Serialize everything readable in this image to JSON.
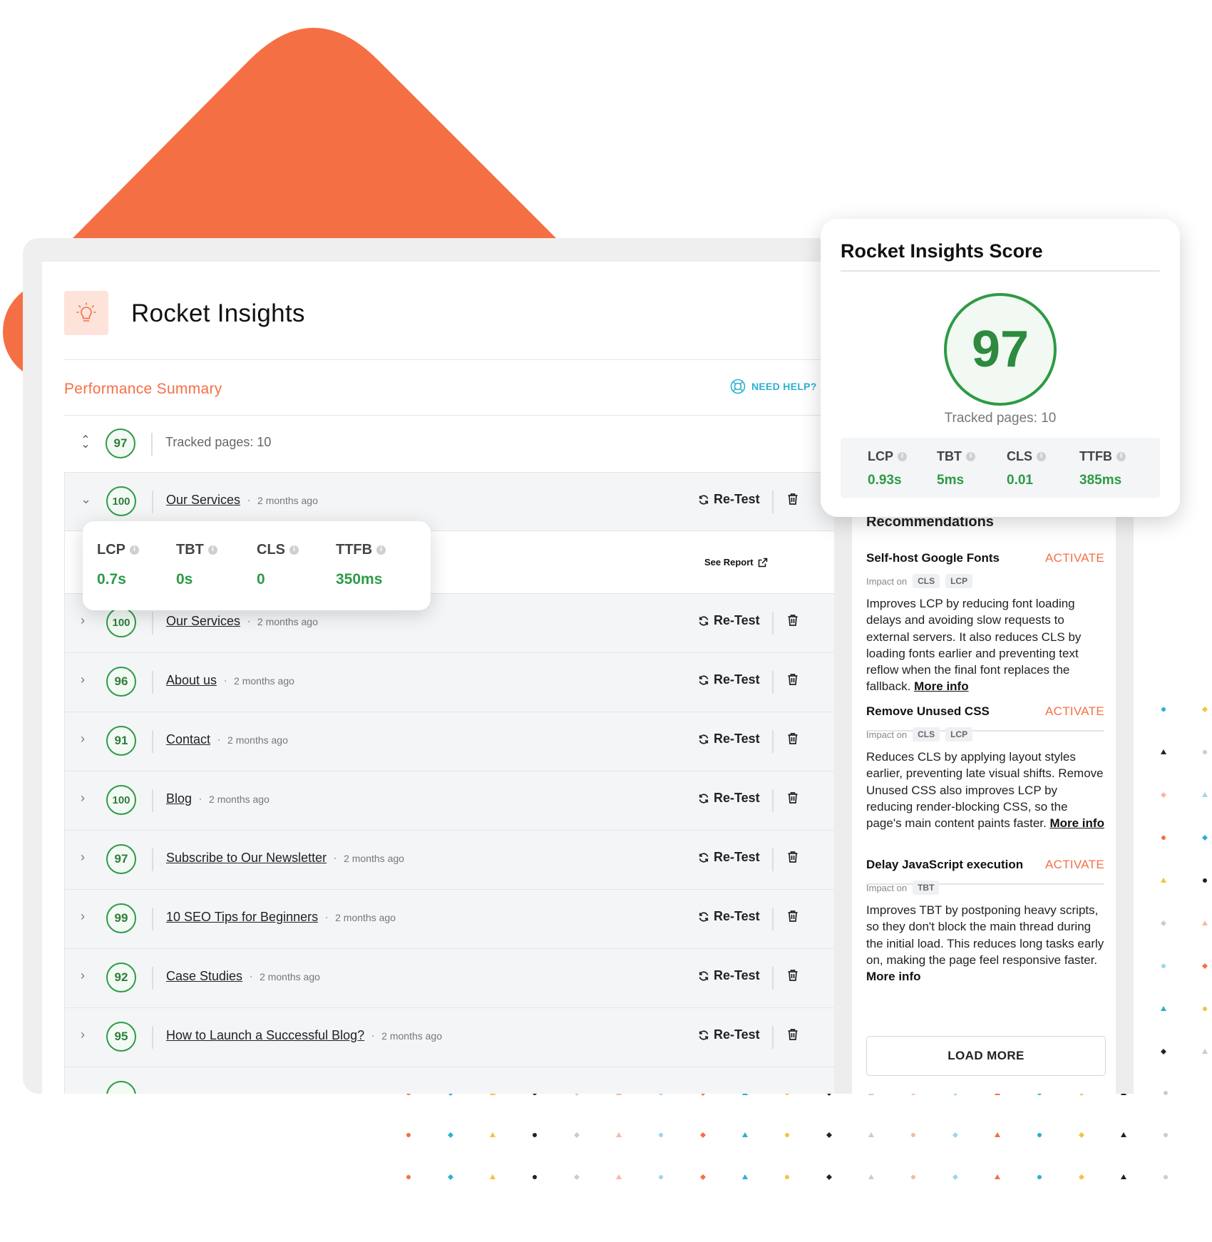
{
  "colors": {
    "accent": "#f56f45",
    "score_green": "#2e9a47",
    "help_cyan": "#2cb0cf"
  },
  "app": {
    "title": "Rocket Insights",
    "logo_icon": "lightbulb-icon"
  },
  "performance": {
    "title": "Performance Summary",
    "need_help": "NEED HELP?",
    "summary_score": "97",
    "tracked_pages": "Tracked pages: 10"
  },
  "expanded_metrics": {
    "see_report": "See Report",
    "items": [
      {
        "label": "LCP",
        "value": "0.7s"
      },
      {
        "label": "TBT",
        "value": "0s"
      },
      {
        "label": "CLS",
        "value": "0"
      },
      {
        "label": "TTFB",
        "value": "350ms"
      }
    ]
  },
  "retest_label": "Re-Test",
  "pages": [
    {
      "score": "100",
      "name": "Our Services",
      "ago": "2 months ago"
    },
    {
      "score": "100",
      "name": "Our Services",
      "ago": "2 months ago"
    },
    {
      "score": "96",
      "name": "About us",
      "ago": "2 months ago"
    },
    {
      "score": "91",
      "name": "Contact",
      "ago": "2 months ago"
    },
    {
      "score": "100",
      "name": "Blog",
      "ago": "2 months ago"
    },
    {
      "score": "97",
      "name": "Subscribe to Our Newsletter",
      "ago": "2 months ago"
    },
    {
      "score": "99",
      "name": "10 SEO Tips for Beginners",
      "ago": "2 months ago"
    },
    {
      "score": "92",
      "name": "Case Studies",
      "ago": "2 months ago"
    },
    {
      "score": "95",
      "name": "How to Launch a Successful Blog?",
      "ago": "2 months ago"
    }
  ],
  "score_card": {
    "title": "Rocket Insights Score",
    "score": "97",
    "tracked_pages": "Tracked pages: 10",
    "metrics": [
      {
        "label": "LCP",
        "value": "0.93s"
      },
      {
        "label": "TBT",
        "value": "5ms"
      },
      {
        "label": "CLS",
        "value": "0.01"
      },
      {
        "label": "TTFB",
        "value": "385ms"
      }
    ]
  },
  "recommendations": {
    "title": "Recommendations",
    "impact_label": "Impact on",
    "activate_label": "ACTIVATE",
    "more_info": "More info",
    "load_more": "LOAD MORE",
    "items": [
      {
        "name": "Self-host Google Fonts",
        "impact": [
          "CLS",
          "LCP"
        ],
        "description": "Improves LCP by reducing font loading delays and avoiding slow requests to external servers. It also reduces CLS by loading fonts earlier and preventing text reflow when the final font replaces the fallback."
      },
      {
        "name": "Remove Unused CSS",
        "impact": [
          "CLS",
          "LCP"
        ],
        "description": "Reduces CLS by applying layout styles earlier, preventing late visual shifts. Remove Unused CSS also improves LCP by reducing render-blocking CSS, so the page's main content paints faster."
      },
      {
        "name": "Delay JavaScript execution",
        "impact": [
          "TBT"
        ],
        "description": "Improves TBT by postponing heavy scripts, so they don't block the main thread during the initial load. This reduces long tasks early on, making the page feel responsive faster."
      }
    ]
  }
}
